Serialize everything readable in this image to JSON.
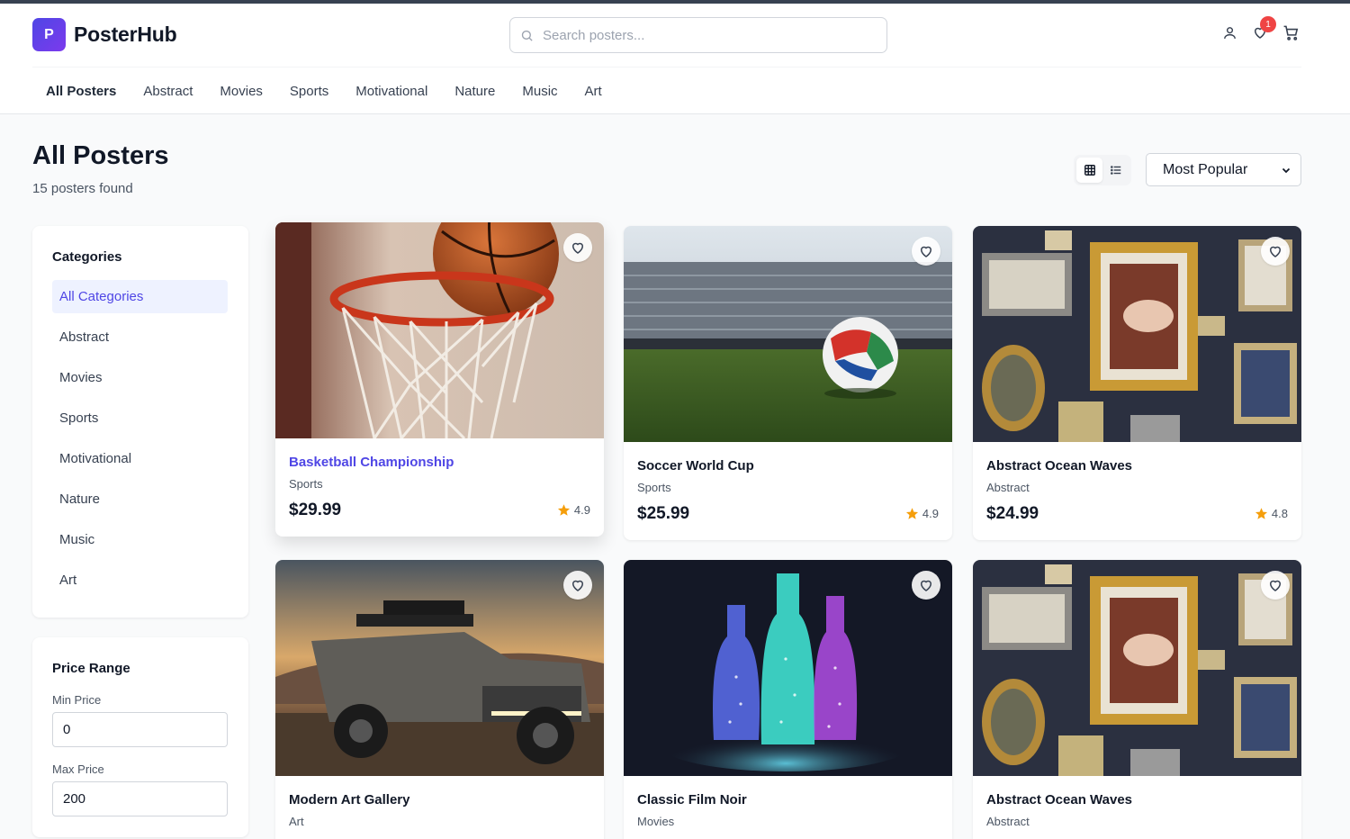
{
  "brand": {
    "logo_letter": "P",
    "name": "PosterHub"
  },
  "search": {
    "placeholder": "Search posters...",
    "value": ""
  },
  "header": {
    "wishlist_count": "1"
  },
  "nav": [
    "All Posters",
    "Abstract",
    "Movies",
    "Sports",
    "Motivational",
    "Nature",
    "Music",
    "Art"
  ],
  "page": {
    "title": "All Posters",
    "count": "15 posters found",
    "sort_value": "Most Popular",
    "view_mode": "grid"
  },
  "filters": {
    "categories_title": "Categories",
    "categories": [
      "All Categories",
      "Abstract",
      "Movies",
      "Sports",
      "Motivational",
      "Nature",
      "Music",
      "Art"
    ],
    "price_title": "Price Range",
    "min_label": "Min Price",
    "min_value": "0",
    "max_label": "Max Price",
    "max_value": "200"
  },
  "products": [
    {
      "name": "Basketball Championship",
      "category": "Sports",
      "price": "$29.99",
      "rating": "4.9",
      "image": "basketball-hoop"
    },
    {
      "name": "Soccer World Cup",
      "category": "Sports",
      "price": "$25.99",
      "rating": "4.9",
      "image": "soccer-stadium"
    },
    {
      "name": "Abstract Ocean Waves",
      "category": "Abstract",
      "price": "$24.99",
      "rating": "4.8",
      "image": "framed-art-wall"
    },
    {
      "name": "Modern Art Gallery",
      "category": "Art",
      "price": "",
      "rating": "",
      "image": "offroad-truck"
    },
    {
      "name": "Classic Film Noir",
      "category": "Movies",
      "price": "",
      "rating": "",
      "image": "glowing-bottles"
    },
    {
      "name": "Abstract Ocean Waves",
      "category": "Abstract",
      "price": "",
      "rating": "",
      "image": "framed-art-wall"
    }
  ],
  "colors": {
    "accent": "#4f46e5",
    "badge": "#ef4444",
    "star": "#f59e0b"
  }
}
